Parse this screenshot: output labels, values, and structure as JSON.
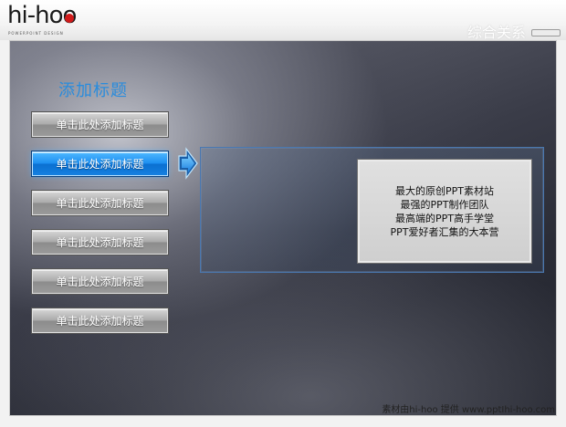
{
  "header": {
    "logo_text": "hi-hoo",
    "logo_subtitle": "POWERPOINT DESIGN",
    "slide_title": "综合关系"
  },
  "main": {
    "section_title": "添加标题",
    "menu_buttons": [
      {
        "label": "单击此处添加标题",
        "active": false
      },
      {
        "label": "单击此处添加标题",
        "active": true
      },
      {
        "label": "单击此处添加标题",
        "active": false
      },
      {
        "label": "单击此处添加标题",
        "active": false
      },
      {
        "label": "单击此处添加标题",
        "active": false
      },
      {
        "label": "单击此处添加标题",
        "active": false
      }
    ],
    "text_box_lines": [
      "最大的原创PPT素材站",
      "最强的PPT制作团队",
      "最高端的PPT高手学堂",
      "PPT爱好者汇集的大本营"
    ]
  },
  "footer": {
    "credit": "素材由hi-hoo 提供  www.pptIhi-hoo.com"
  },
  "colors": {
    "accent": "#1a8df0",
    "title_blue": "#2a8cdc",
    "logo_red": "#d11b1b"
  }
}
